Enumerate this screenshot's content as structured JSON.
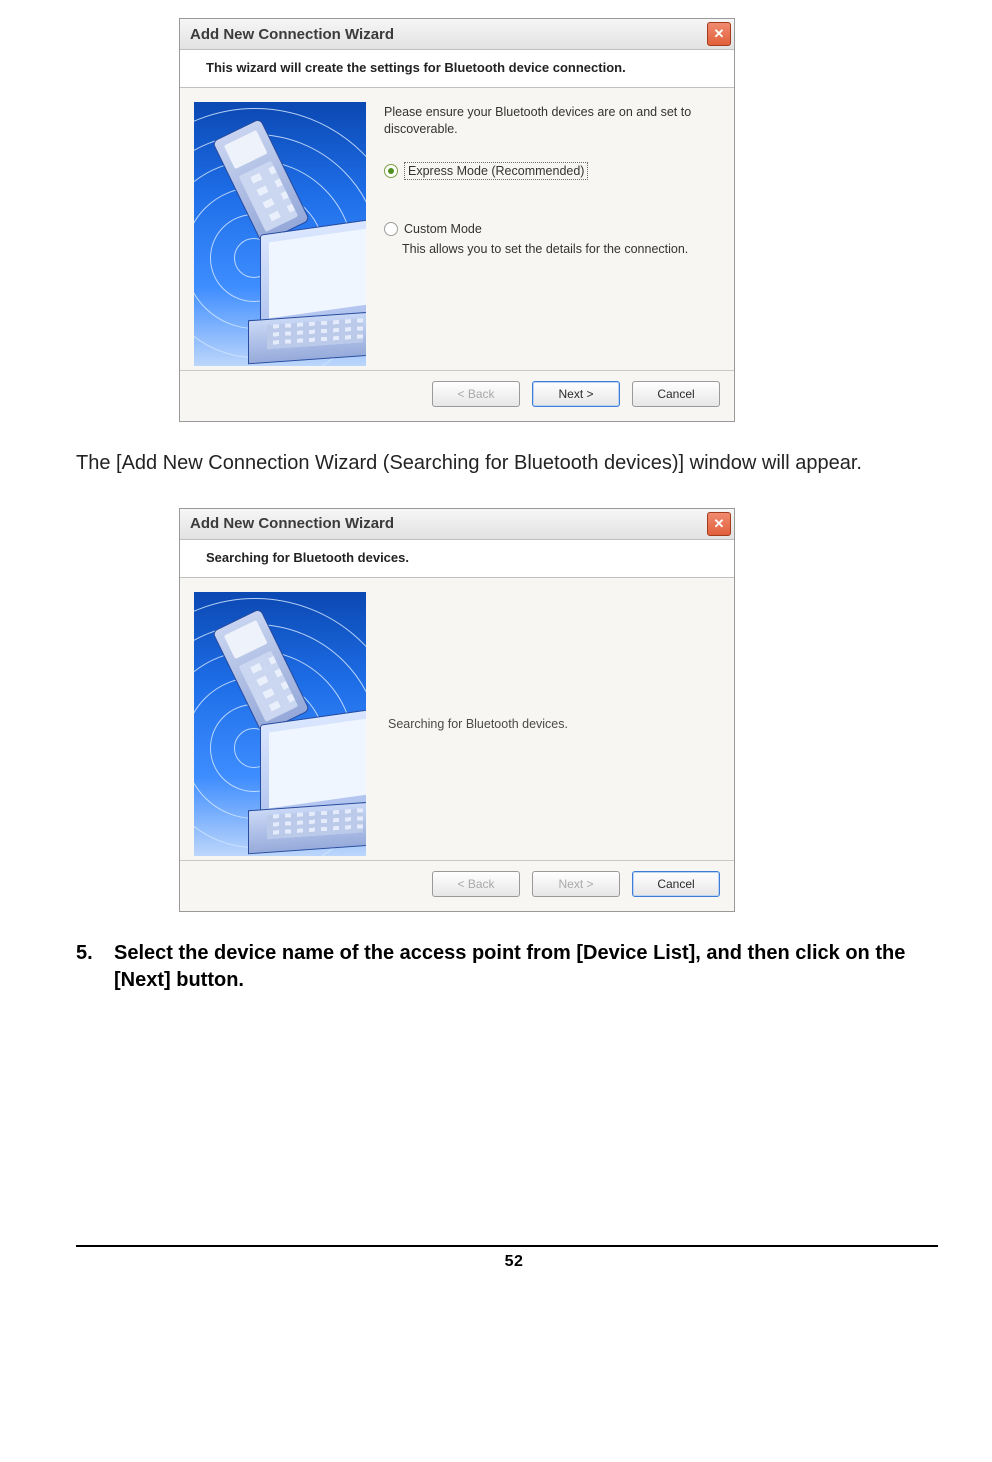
{
  "dialog1": {
    "title": "Add New Connection Wizard",
    "heading": "This wizard will create the settings for Bluetooth device connection.",
    "intro": "Please ensure your Bluetooth devices are on and set to discoverable.",
    "radio_express": "Express Mode (Recommended)",
    "radio_custom": "Custom Mode",
    "custom_sub": "This allows you to set the details for the connection.",
    "back": "< Back",
    "next": "Next >",
    "cancel": "Cancel"
  },
  "doc": {
    "paragraph": "The [Add New Connection Wizard (Searching for Bluetooth devices)] window will appear."
  },
  "dialog2": {
    "title": "Add New Connection Wizard",
    "heading": "Searching for Bluetooth devices.",
    "status": "Searching for Bluetooth devices.",
    "back": "< Back",
    "next": "Next >",
    "cancel": "Cancel"
  },
  "step": {
    "num": "5.",
    "text": "Select the device name of the access point from [Device List], and then click on the [Next] button."
  },
  "page_number": "52"
}
